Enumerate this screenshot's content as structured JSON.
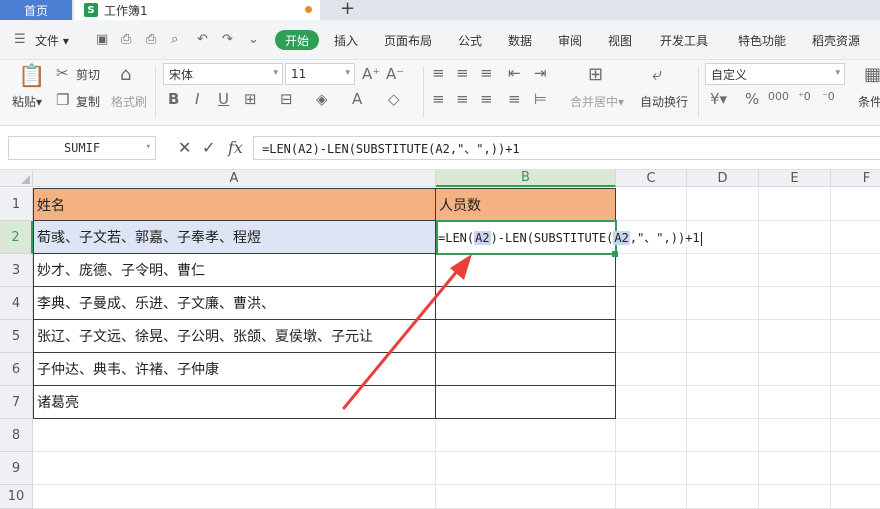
{
  "tabs": {
    "home": "首页",
    "workbook": "工作簿1",
    "workbook_logo": "S"
  },
  "menu": {
    "file": "文件",
    "active": "开始",
    "items": [
      "插入",
      "页面布局",
      "公式",
      "数据",
      "审阅",
      "视图",
      "开发工具",
      "特色功能",
      "稻壳资源"
    ]
  },
  "ribbon": {
    "paste": "粘贴",
    "cut": "剪切",
    "copy": "复制",
    "format_painter": "格式刷",
    "font_name": "宋体",
    "font_size": "11",
    "merge_center": "合并居中",
    "wrap_text": "自动换行",
    "number_format": "自定义",
    "conditional": "条件"
  },
  "formula_bar": {
    "name_box": "SUMIF",
    "fx": "fx",
    "formula": "=LEN(A2)-LEN(SUBSTITUTE(A2,\"、\",))+1"
  },
  "columns": [
    "A",
    "B",
    "C",
    "D",
    "E",
    "F"
  ],
  "rows": [
    "1",
    "2",
    "3",
    "4",
    "5",
    "6",
    "7",
    "8",
    "9",
    "10"
  ],
  "sheet": {
    "header_a": "姓名",
    "header_b": "人员数",
    "names": [
      "荀彧、子文若、郭嘉、子奉孝、程煜",
      "妙才、庞德、子令明、曹仁",
      "李典、子曼成、乐进、子文廉、曹洪、",
      "张辽、子文远、徐晃、子公明、张颌、夏侯墩、子元让",
      "子仲达、典韦、许褚、子仲康",
      "诸葛亮"
    ],
    "edit": {
      "p1": "=LEN(",
      "r1": "A2",
      "p2": ")-LEN(SUBSTITUTE(",
      "r2": "A2",
      "p3": ",\"、\",))+1"
    }
  },
  "colors": {
    "accent": "#2f9e56",
    "header_fill": "#f4b184",
    "selection": "#dde4f3",
    "arrow": "#e8403a"
  }
}
